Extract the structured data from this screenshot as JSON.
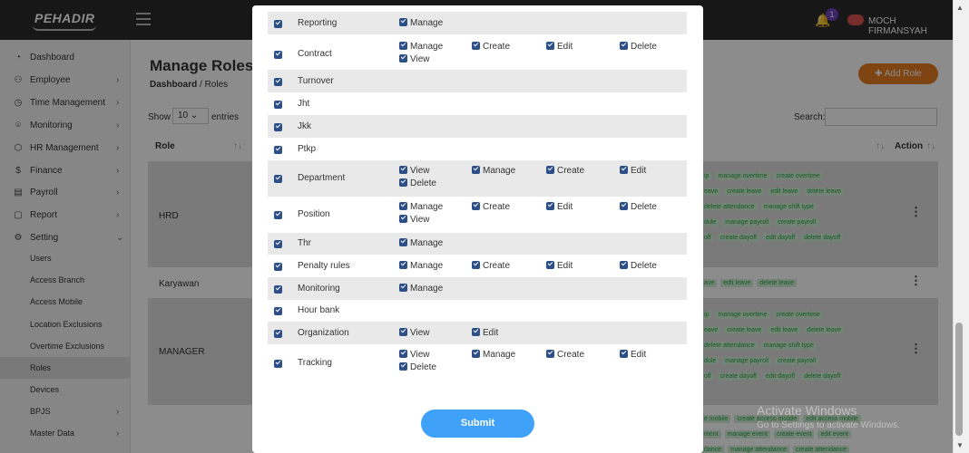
{
  "app": {
    "logo": "PEHADIR",
    "user_name": "MOCH FIRMANSYAH",
    "notification_count": "1"
  },
  "sidebar": {
    "items": [
      {
        "label": "Dashboard",
        "icon": "gauge-icon",
        "glyph": "◔"
      },
      {
        "label": "Employee",
        "icon": "users-icon",
        "glyph": "⚇"
      },
      {
        "label": "Time Management",
        "icon": "clock-icon",
        "glyph": "◷"
      },
      {
        "label": "Monitoring",
        "icon": "map-pin-icon",
        "glyph": "⌾"
      },
      {
        "label": "HR Management",
        "icon": "box-icon",
        "glyph": "⬡"
      },
      {
        "label": "Finance",
        "icon": "dollar-icon",
        "glyph": "$"
      },
      {
        "label": "Payroll",
        "icon": "wallet-icon",
        "glyph": "▤"
      },
      {
        "label": "Report",
        "icon": "document-icon",
        "glyph": "▢"
      },
      {
        "label": "Setting",
        "icon": "gear-icon",
        "glyph": "⚙"
      }
    ],
    "sub_items": [
      "Users",
      "Access Branch",
      "Access Mobile",
      "Location Exclusions",
      "Overtime Exclusions",
      "Roles",
      "Devices"
    ],
    "extra_items": [
      "BPJS",
      "Master Data"
    ]
  },
  "page": {
    "title": "Manage Roles",
    "crumb_home": "Dashboard",
    "crumb_sep": "/",
    "crumb_current": "Roles",
    "add_button": "Add Role"
  },
  "table": {
    "show": "Show",
    "page_size": "10",
    "entries": "entries",
    "search": "Search:",
    "col_role": "Role",
    "col_action": "Action",
    "rows": [
      "HRD",
      "Karyawan",
      "MANAGER"
    ],
    "tag_lines": [
      [
        "ip",
        "manage overtime",
        "create overtime"
      ],
      [
        "eave",
        "create leave",
        "edit leave",
        "delete leave"
      ],
      [
        "",
        "delete attendance",
        "manage shift type"
      ],
      [
        "dule",
        "manage payroll",
        "create payroll"
      ],
      [
        "off",
        "create dayoff",
        "edit dayoff",
        "delete dayoff"
      ],
      [
        "ave",
        "edit leave",
        "delete leave"
      ],
      [
        "ip",
        "manage overtime",
        "create overtime"
      ],
      [
        "eave",
        "create leave",
        "edit leave",
        "delete leave"
      ],
      [
        "",
        "delete attendance",
        "manage shift type"
      ],
      [
        "dule",
        "manage payroll",
        "create payroll"
      ],
      [
        "off",
        "create dayoff",
        "edit dayoff",
        "delete dayoff"
      ],
      [
        "e mobile",
        "create access mobile",
        "edit access mobile"
      ],
      [
        "ment",
        "manage event",
        "create event",
        "edit event"
      ],
      [
        "dance",
        "manage attendance",
        "create attendance"
      ]
    ]
  },
  "modal": {
    "submit": "Submit",
    "permissions": [
      {
        "name": "Reporting",
        "options": [
          "Manage"
        ]
      },
      {
        "name": "Contract",
        "options": [
          "Manage",
          "Create",
          "Edit",
          "Delete",
          "View"
        ]
      },
      {
        "name": "Turnover",
        "options": []
      },
      {
        "name": "Jht",
        "options": []
      },
      {
        "name": "Jkk",
        "options": []
      },
      {
        "name": "Ptkp",
        "options": []
      },
      {
        "name": "Department",
        "options": [
          "View",
          "Manage",
          "Create",
          "Edit",
          "Delete"
        ]
      },
      {
        "name": "Position",
        "options": [
          "Manage",
          "Create",
          "Edit",
          "Delete",
          "View"
        ]
      },
      {
        "name": "Thr",
        "options": [
          "Manage"
        ]
      },
      {
        "name": "Penalty rules",
        "options": [
          "Manage",
          "Create",
          "Edit",
          "Delete"
        ]
      },
      {
        "name": "Monitoring",
        "options": [
          "Manage"
        ]
      },
      {
        "name": "Hour bank",
        "options": []
      },
      {
        "name": "Organization",
        "options": [
          "View",
          "Edit"
        ]
      },
      {
        "name": "Tracking",
        "options": [
          "View",
          "Manage",
          "Create",
          "Edit",
          "Delete"
        ]
      }
    ]
  },
  "watermark": {
    "line1": "Activate Windows",
    "line2": "Go to Settings to activate Windows."
  },
  "colors": {
    "accent": "#3fa1f7",
    "add_button": "#e67e22",
    "checkbox": "#2c4f88",
    "tag_text": "#28a745"
  }
}
